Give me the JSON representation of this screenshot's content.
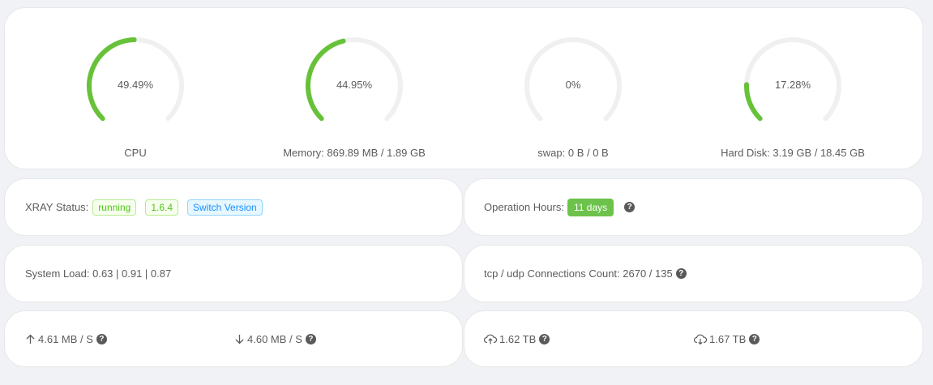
{
  "gauges": [
    {
      "percent": 49.49,
      "percent_text": "49.49%",
      "label": "CPU"
    },
    {
      "percent": 44.95,
      "percent_text": "44.95%",
      "label": "Memory: 869.89 MB / 1.89 GB"
    },
    {
      "percent": 0,
      "percent_text": "0%",
      "label": "swap: 0 B / 0 B"
    },
    {
      "percent": 17.28,
      "percent_text": "17.28%",
      "label": "Hard Disk: 3.19 GB / 18.45 GB"
    }
  ],
  "colors": {
    "gauge_fill": "#67c23a",
    "gauge_track": "#f0f0f0"
  },
  "xray": {
    "label": "XRAY Status:",
    "status": "running",
    "version": "1.6.4",
    "switch": "Switch Version"
  },
  "operation": {
    "label": "Operation Hours:",
    "value": "11 days",
    "help": "?"
  },
  "load": {
    "text": "System Load: 0.63 | 0.91 | 0.87"
  },
  "connections": {
    "text": "tcp / udp Connections Count: 2670 / 135",
    "help": "?"
  },
  "speed": {
    "up": "4.61 MB / S",
    "down": "4.60 MB / S",
    "help": "?"
  },
  "traffic": {
    "sent": "1.62 TB",
    "received": "1.67 TB",
    "help": "?"
  }
}
